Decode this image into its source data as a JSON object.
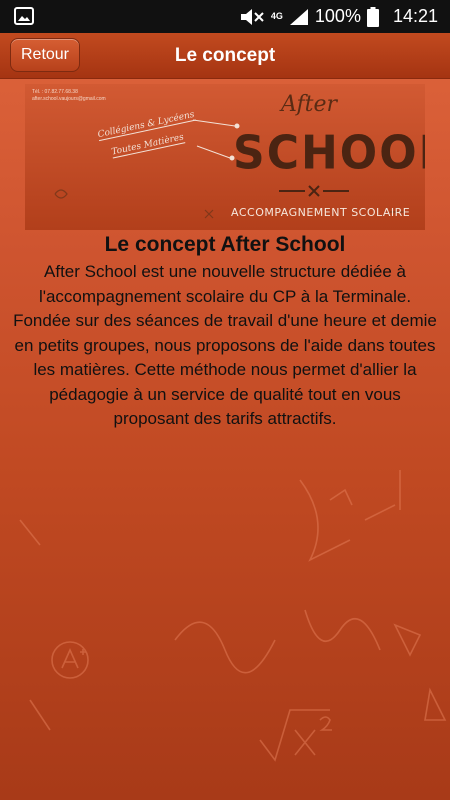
{
  "status_bar": {
    "icons": [
      "image-icon",
      "mute-icon",
      "4g-icon",
      "signal-icon",
      "battery-icon"
    ],
    "network": "4G",
    "battery": "100%",
    "time": "14:21"
  },
  "app_bar": {
    "back_label": "Retour",
    "title": "Le concept"
  },
  "banner": {
    "contact_phone": "Tél. : 07.82.77.68.38",
    "contact_email": "after.school.vaujours@gmail.com",
    "tag_1": "Collégiens & Lycéens",
    "tag_2": "Toutes Matières",
    "brand_top": "After",
    "brand_main": "SCHOOL",
    "brand_tagline": "ACCOMPAGNEMENT SCOLAIRE"
  },
  "content": {
    "heading": "Le concept After School",
    "body": "After School est une nouvelle structure dédiée à l'accompagnement scolaire du CP à la Terminale. Fondée sur des séances de travail d'une heure et demie en petits groupes, nous proposons de l'aide dans toutes les matières. Cette méthode nous permet d'allier la pédagogie à un service de qualité tout en vous proposant des tarifs attractifs."
  },
  "colors": {
    "status_bar_bg": "#111111",
    "app_bar_bg": "#b03c17",
    "background": "#c9512a",
    "brand_dark": "#4b2412"
  }
}
